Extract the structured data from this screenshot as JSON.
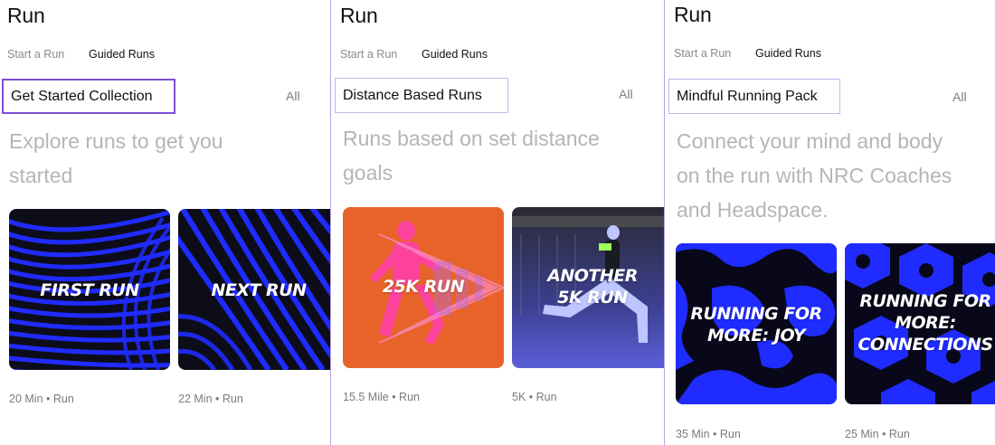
{
  "colors": {
    "accent_purple": "#7a4fd6",
    "nrc_blue": "#1f2bff",
    "orange": "#e8632a",
    "pink": "#ff3fa8",
    "muted_text": "#b5b5b5"
  },
  "panels": [
    {
      "title": "Run",
      "tabs": [
        "Start a Run",
        "Guided Runs"
      ],
      "active_tab": "Guided Runs",
      "collection": {
        "name": "Get Started Collection",
        "all_label": "All"
      },
      "description_lines": [
        "Explore runs to get you",
        "started"
      ],
      "cards": [
        {
          "label": "FIRST RUN",
          "meta": "20 Min • Run",
          "art": "blue-wave-pattern"
        },
        {
          "label": "NEXT RUN",
          "meta": "22 Min • Run",
          "art": "blue-wave-pattern"
        }
      ]
    },
    {
      "title": "Run",
      "tabs": [
        "Start a Run",
        "Guided Runs"
      ],
      "active_tab": "Guided Runs",
      "collection": {
        "name": "Distance Based Runs",
        "all_label": "All"
      },
      "description_lines": [
        "Runs based on set distance",
        "goals"
      ],
      "cards": [
        {
          "label": "25K RUN",
          "meta": "15.5 Mile • Run",
          "art": "orange-runner-silhouettes"
        },
        {
          "label": "ANOTHER\n5K RUN",
          "meta": "5K • Run",
          "art": "runner-photo-blue"
        }
      ]
    },
    {
      "title": "Run",
      "tabs": [
        "Start a Run",
        "Guided Runs"
      ],
      "active_tab": "Guided Runs",
      "collection": {
        "name": "Mindful Running Pack",
        "all_label": "All"
      },
      "description_lines": [
        "Connect your mind and body",
        "on the run with NRC Coaches",
        "and Headspace."
      ],
      "cards": [
        {
          "label": "RUNNING FOR\nMORE: JOY",
          "meta": "35 Min • Run",
          "art": "blue-blob-pattern"
        },
        {
          "label": "RUNNING FOR\nMORE:\nCONNECTIONS",
          "meta": "25 Min • Run",
          "art": "blue-hexagon-pattern"
        }
      ]
    }
  ]
}
